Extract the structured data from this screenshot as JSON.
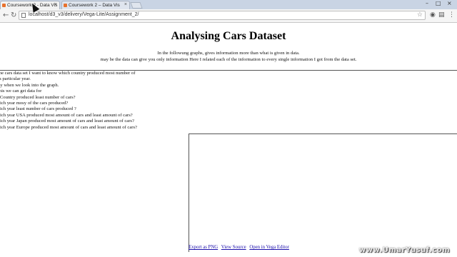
{
  "browser": {
    "tabs": [
      {
        "label": "Coursework 2 - Data Vis",
        "active": true
      },
      {
        "label": "Coursework 2 – Data Vis",
        "active": false
      }
    ],
    "url": "localhost/d3_v3/delivery/Vega-Lite/Assignment_2/"
  },
  "page": {
    "title": "Analysing Cars Dataset",
    "intro_line1": "In the followung graphs, gives information more than what is given in data.",
    "intro_line2": "may be the data can give you only information Here I related each of the information to every single information I got from the data set.",
    "questions": [
      "n the cars data set I want to know which country produced most number of",
      "in a particular year.",
      "easy when we look into the graph.",
      "o this we can get data for",
      "ch Country produced least number of cars?",
      "which year mosy of the cars produced?",
      "which year least number of cars produced ?",
      "which year USA produced most amount of cars and least amount of cars?",
      "which year Japan produced most amount of cars and least amount of cars?",
      "which year Europe produced most amount of cars and least amount of cars?"
    ],
    "links": {
      "export": "Export as PNG",
      "source": "View Source",
      "editor": "Open in Vega Editor"
    }
  },
  "watermark": "www.UmarYusuf.com"
}
